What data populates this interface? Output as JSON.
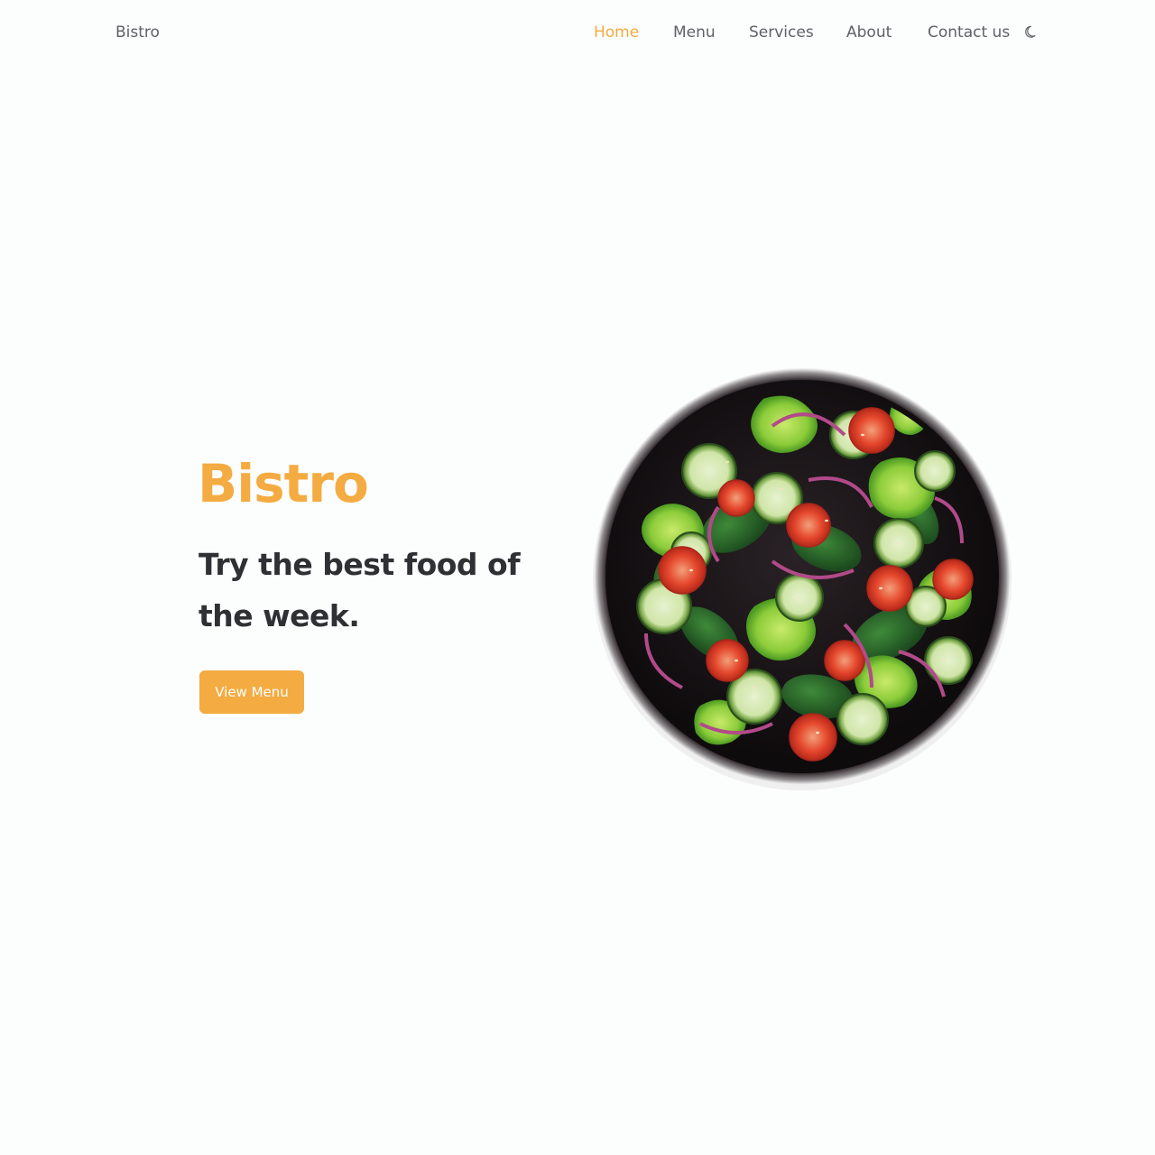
{
  "header": {
    "brand": "Bistro",
    "nav": [
      {
        "label": "Home",
        "active": true
      },
      {
        "label": "Menu",
        "active": false
      },
      {
        "label": "Services",
        "active": false
      },
      {
        "label": "About",
        "active": false
      },
      {
        "label": "Contact us",
        "active": false
      }
    ],
    "theme_toggle_icon": "moon-icon"
  },
  "hero": {
    "title": "Bistro",
    "subtitle": "Try the best food of the week.",
    "button_label": "View Menu",
    "image": "salad-bowl-image"
  },
  "colors": {
    "accent": "#f4ab41",
    "text_dark": "#2f3033",
    "text_muted": "#5f6166",
    "background": "#fcfdfd"
  }
}
